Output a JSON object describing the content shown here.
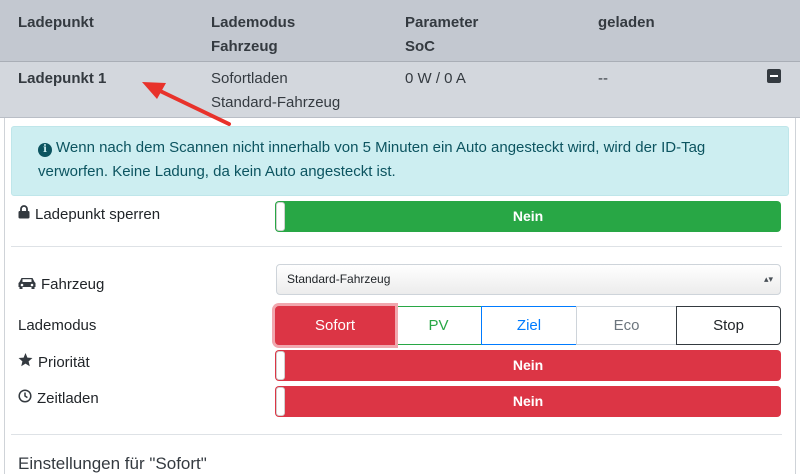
{
  "table_header": {
    "col1": "Ladepunkt",
    "col2_line1": "Lademodus",
    "col2_line2": "Fahrzeug",
    "col3_line1": "Parameter",
    "col3_line2": "SoC",
    "col4": "geladen"
  },
  "chargepoint_row": {
    "name": "Ladepunkt 1",
    "mode": "Sofortladen",
    "vehicle": "Standard-Fahrzeug",
    "params": "0 W / 0 A",
    "charged": "--"
  },
  "alert": {
    "text": "Wenn nach dem Scannen nicht innerhalb von 5 Minuten ein Auto angesteckt wird, wird der ID-Tag verworfen. Keine Ladung, da kein Auto angesteckt ist."
  },
  "lock": {
    "label": "Ladepunkt sperren",
    "value": "Nein"
  },
  "vehicle": {
    "label": "Fahrzeug",
    "selected": "Standard-Fahrzeug"
  },
  "chargemode": {
    "label": "Lademodus",
    "options": [
      "Sofort",
      "PV",
      "Ziel",
      "Eco",
      "Stop"
    ],
    "selected": "Sofort"
  },
  "priority": {
    "label": "Priorität",
    "value": "Nein"
  },
  "timecharge": {
    "label": "Zeitladen",
    "value": "Nein"
  },
  "section_title": "Einstellungen für \"Sofort\"",
  "colors": {
    "header_bg": "#c3c8d0",
    "row_bg": "#d3d7dd",
    "alert_bg": "#cdeef1",
    "green": "#28a745",
    "red": "#dc3545",
    "annotation_arrow": "#e8322b"
  },
  "icons": [
    "minus-square-icon",
    "info-circle-icon",
    "lock-icon",
    "car-icon",
    "star-icon",
    "clock-icon",
    "select-arrows-icon",
    "annotation-arrow"
  ]
}
